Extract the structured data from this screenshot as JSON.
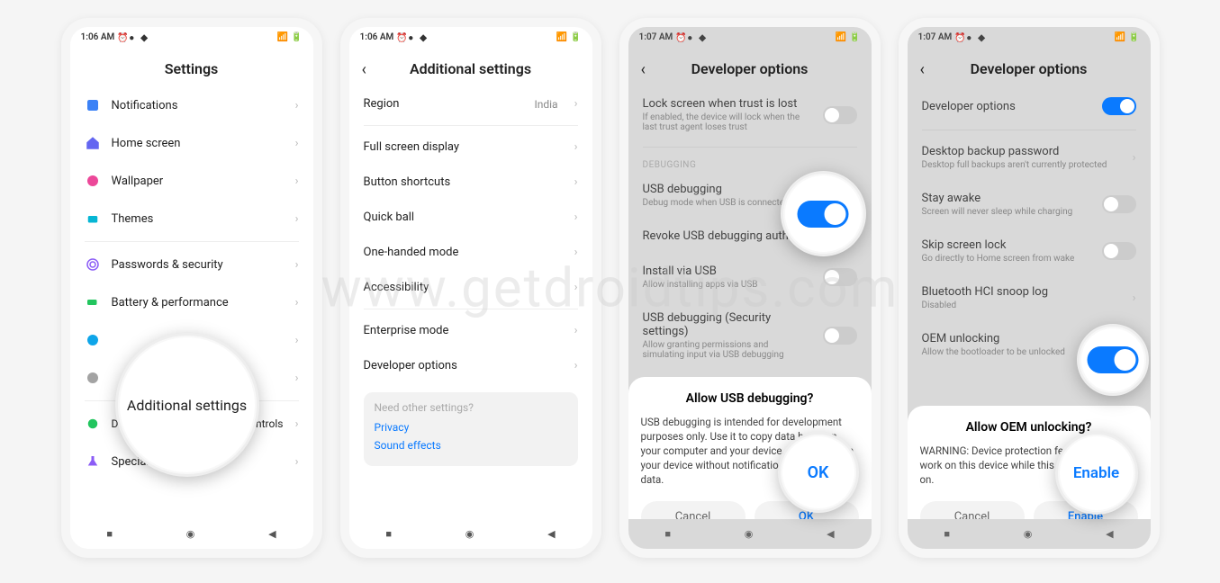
{
  "watermark": "www.getdroidtips.com",
  "status_time_a": "1:06 AM",
  "status_time_b": "1:07 AM",
  "phone1": {
    "title": "Settings",
    "items": [
      {
        "icon": "notif",
        "label": "Notifications"
      },
      {
        "icon": "home",
        "label": "Home screen"
      },
      {
        "icon": "wall",
        "label": "Wallpaper"
      },
      {
        "icon": "theme",
        "label": "Themes"
      }
    ],
    "items2": [
      {
        "icon": "lock",
        "label": "Passwords & security"
      },
      {
        "icon": "batt",
        "label": "Battery & performance"
      },
      {
        "icon": "gear",
        "label": ""
      },
      {
        "icon": "globe",
        "label": ""
      }
    ],
    "items3": [
      {
        "icon": "well",
        "label": "Digital wellbeing & parental controls"
      },
      {
        "icon": "spec",
        "label": "Special features"
      }
    ],
    "bubble_text": "Additional settings"
  },
  "phone2": {
    "title": "Additional settings",
    "region_label": "Region",
    "region_value": "India",
    "items": [
      "Full screen display",
      "Button shortcuts",
      "Quick ball",
      "One-handed mode",
      "Accessibility"
    ],
    "items2": [
      "Enterprise mode",
      "Developer options"
    ],
    "need_hint": "Need other settings?",
    "need_links": [
      "Privacy",
      "Sound effects"
    ]
  },
  "phone3": {
    "title": "Developer options",
    "lock_label": "Lock screen when trust is lost",
    "lock_sub": "If enabled, the device will lock when the last trust agent loses trust",
    "section": "DEBUGGING",
    "usb_label": "USB debugging",
    "usb_sub": "Debug mode when USB is connected",
    "revoke_label": "Revoke USB debugging authorizations",
    "install_label": "Install via USB",
    "install_sub": "Allow installing apps via USB",
    "sec_label": "USB debugging (Security settings)",
    "sec_sub": "Allow granting permissions and simulating input via USB debugging",
    "dialog_title": "Allow USB debugging?",
    "dialog_body": "USB debugging is intended for development purposes only. Use it to copy data between your computer and your device, install apps on your device without notification, and read log data.",
    "cancel": "Cancel",
    "ok": "OK"
  },
  "phone4": {
    "title": "Developer options",
    "dev_label": "Developer options",
    "desk_label": "Desktop backup password",
    "desk_sub": "Desktop full backups aren't currently protected",
    "stay_label": "Stay awake",
    "stay_sub": "Screen will never sleep while charging",
    "skip_label": "Skip screen lock",
    "skip_sub": "Go directly to Home screen from wake",
    "bt_label": "Bluetooth HCI snoop log",
    "bt_sub": "Disabled",
    "oem_label": "OEM unlocking",
    "oem_sub": "Allow the bootloader to be unlocked",
    "dialog_title": "Allow OEM unlocking?",
    "dialog_body": "WARNING: Device protection features will not work on this device while this setting is turned on.",
    "cancel": "Cancel",
    "enable": "Enable"
  }
}
